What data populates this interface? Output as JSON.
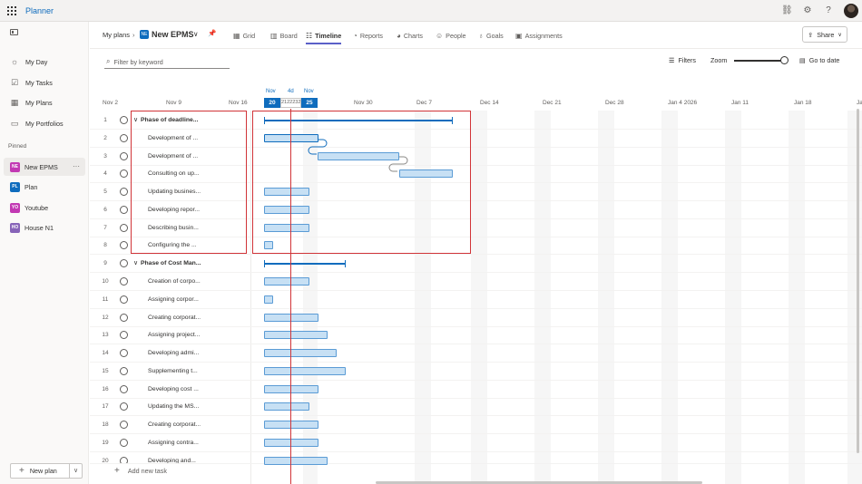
{
  "app": {
    "name": "Planner"
  },
  "sidebar": {
    "items": [
      {
        "label": "My Day",
        "icon": "sun-icon"
      },
      {
        "label": "My Tasks",
        "icon": "tasks-icon"
      },
      {
        "label": "My Plans",
        "icon": "grid-icon"
      },
      {
        "label": "My Portfolios",
        "icon": "folder-icon"
      }
    ],
    "pinned_label": "Pinned",
    "pinned": [
      {
        "label": "New EPMS",
        "badge": "NE",
        "color": "#c239b3"
      },
      {
        "label": "Plan",
        "badge": "PL",
        "color": "#0f6cbd"
      },
      {
        "label": "Youtube",
        "badge": "YO",
        "color": "#c239b3"
      },
      {
        "label": "House N1",
        "badge": "HO",
        "color": "#8764b8"
      }
    ],
    "new_plan": "New plan"
  },
  "header": {
    "breadcrumb": "My plans",
    "plan_badge": "NE",
    "plan_title": "New EPMS",
    "tabs": [
      {
        "label": "Grid",
        "icon": "grid-icon"
      },
      {
        "label": "Board",
        "icon": "board-icon"
      },
      {
        "label": "Timeline",
        "icon": "timeline-icon",
        "active": true
      },
      {
        "label": "Reports",
        "icon": "reports-icon"
      },
      {
        "label": "Charts",
        "icon": "charts-icon"
      },
      {
        "label": "People",
        "icon": "people-icon"
      },
      {
        "label": "Goals",
        "icon": "goals-icon"
      },
      {
        "label": "Assignments",
        "icon": "assignments-icon"
      }
    ],
    "share": "Share"
  },
  "toolbar": {
    "search_placeholder": "Filter by keyword",
    "filters": "Filters",
    "zoom": "Zoom",
    "zoom_level": 1.0,
    "goto": "Go to date"
  },
  "timeline": {
    "dates": [
      "Nov 2",
      "Nov 9",
      "Nov 16",
      "Nov 30",
      "Dec 7",
      "Dec 14",
      "Dec 21",
      "Dec 28",
      "Jan 4 2026",
      "Jan 11",
      "Jan 18",
      "Ja"
    ],
    "today_month": "Nov",
    "today_day": "20",
    "duration_label": "4d",
    "mid_days": "21222324",
    "end_month": "Nov",
    "end_day": "25"
  },
  "tasks": [
    {
      "num": "1",
      "name": "Phase of deadline...",
      "phase": true
    },
    {
      "num": "2",
      "name": "Development of ..."
    },
    {
      "num": "3",
      "name": "Development of ..."
    },
    {
      "num": "4",
      "name": "Consulting on up..."
    },
    {
      "num": "5",
      "name": "Updating busines..."
    },
    {
      "num": "6",
      "name": "Developing repor..."
    },
    {
      "num": "7",
      "name": "Describing busin..."
    },
    {
      "num": "8",
      "name": "Configuring the ..."
    },
    {
      "num": "9",
      "name": "Phase of Cost Man...",
      "phase": true
    },
    {
      "num": "10",
      "name": "Creation of corpo..."
    },
    {
      "num": "11",
      "name": "Assigning corpor..."
    },
    {
      "num": "12",
      "name": "Creating corporat..."
    },
    {
      "num": "13",
      "name": "Assigning project..."
    },
    {
      "num": "14",
      "name": "Developing admi..."
    },
    {
      "num": "15",
      "name": "Supplementing t..."
    },
    {
      "num": "16",
      "name": "Developing cost ..."
    },
    {
      "num": "17",
      "name": "Updating the MS..."
    },
    {
      "num": "18",
      "name": "Creating corporat..."
    },
    {
      "num": "19",
      "name": "Assigning contra..."
    },
    {
      "num": "20",
      "name": "Developing and..."
    }
  ],
  "add_task": "Add new task"
}
